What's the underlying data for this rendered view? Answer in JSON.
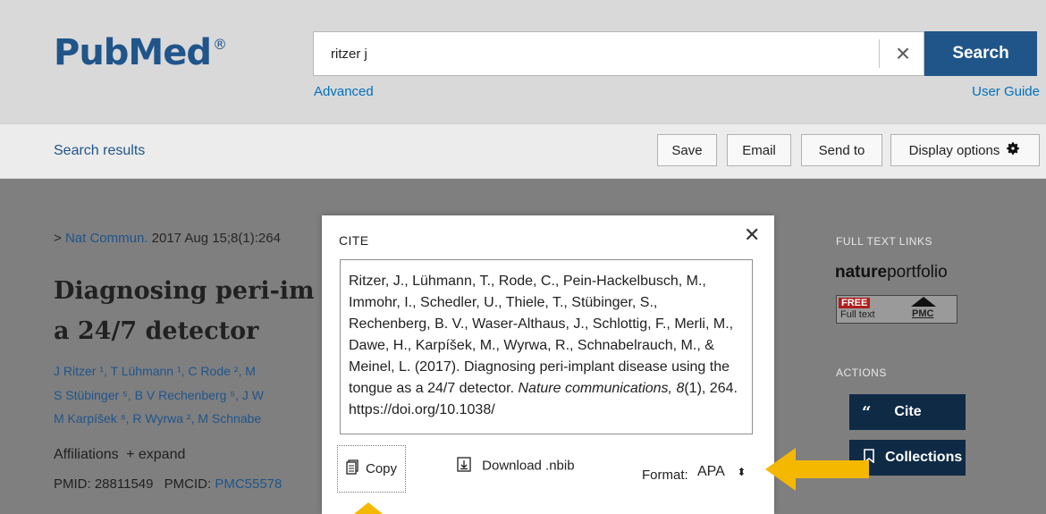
{
  "header": {
    "logo_text": "PubMed",
    "logo_reg": "®",
    "search_value": "ritzer j",
    "search_button": "Search",
    "advanced_link": "Advanced",
    "user_guide_link": "User Guide"
  },
  "toolbar": {
    "search_results_link": "Search results",
    "save": "Save",
    "email": "Email",
    "send_to": "Send to",
    "display_options": "Display options"
  },
  "article": {
    "journal_prefix": ">",
    "journal_name": "Nat Commun.",
    "journal_date": " 2017 Aug 15;8(1):264",
    "title_line1": "Diagnosing peri-im",
    "title_line2": "a 24/7 detector",
    "authors_line1": "J Ritzer ¹, T Lühmann ¹, C Rode ², M",
    "authors_line2": "S Stübinger ⁵, B V Rechenberg ⁵, J W",
    "authors_line3": "M Karpíšek ⁸, R Wyrwa ², M Schnabe",
    "affiliations_label": "Affiliations",
    "expand_label": "+ expand",
    "pmid_label": "PMID:",
    "pmid_value": "28811549",
    "pmcid_label": "PMCID:",
    "pmcid_value": "PMC55578"
  },
  "sidebar": {
    "full_text_links_label": "FULL TEXT LINKS",
    "nature_logo_bold": "nature",
    "nature_logo_rest": "portfolio",
    "free_label": "FREE",
    "full_text_label": "Full text",
    "pmc_label": "PMC",
    "actions_label": "ACTIONS",
    "cite_button": "Cite",
    "collections_button": "Collections"
  },
  "cite_modal": {
    "title": "CITE",
    "citation_part1": "Ritzer, J., Lühmann, T., Rode, C., Pein-Hackelbusch, M., Immohr, I., Schedler, U., Thiele, T., Stübinger, S., Rechenberg, B. V., Waser-Althaus, J., Schlottig, F., Merli, M., Dawe, H., Karpíšek, M., Wyrwa, R., Schnabelrauch, M., & Meinel, L. (2017). Diagnosing peri-implant disease using the tongue as a 24/7 detector. ",
    "citation_journal": "Nature communications, 8",
    "citation_part2": "(1), 264. https://doi.org/10.1038/",
    "copy_button": "Copy",
    "download_button": "Download .nbib",
    "format_label": "Format:",
    "format_value": "APA"
  },
  "colors": {
    "brand_blue": "#20558a",
    "link_blue": "#0071bc",
    "overlay_gray": "#7f7f7f",
    "annotation_arrow": "#f5b800"
  }
}
